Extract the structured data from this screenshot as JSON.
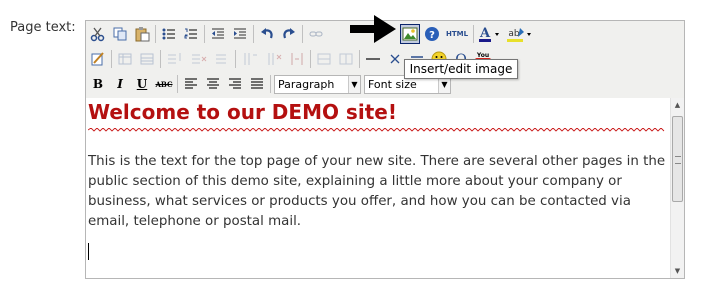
{
  "form": {
    "label": "Page text:"
  },
  "toolbar": {
    "row1": [
      "cut-icon",
      "copy-icon",
      "paste-icon",
      "bullet-list-icon",
      "numbered-list-icon",
      "outdent-icon",
      "indent-icon",
      "undo-icon",
      "redo-icon",
      "insert-image-icon",
      "help-icon",
      "html-icon",
      "font-color-icon",
      "highlight-icon"
    ],
    "html_label": "HTML",
    "paragraph": {
      "value": "Paragraph"
    },
    "font_size": {
      "value": "Font size"
    },
    "bold": "B",
    "italic": "I",
    "underline": "U",
    "strike": "ABC",
    "youtube_label": "You Tube"
  },
  "tooltip": {
    "text": "Insert/edit image"
  },
  "content": {
    "heading": "Welcome to our DEMO site!",
    "paragraph": "This is the text for the top page of your new site.  There are several other pages in the public section of this demo site, explaining a little more about your company or business, what services or products you offer, and how you can be contacted via email, telephone or postal mail."
  },
  "colors": {
    "heading": "#b41010",
    "text": "#333333",
    "accent": "#2a4e8f"
  }
}
